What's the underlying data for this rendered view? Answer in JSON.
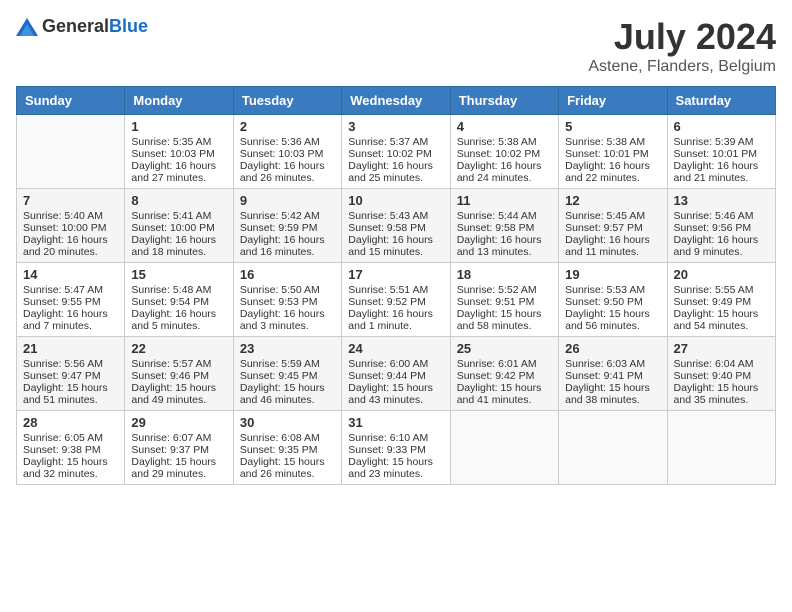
{
  "header": {
    "logo_general": "General",
    "logo_blue": "Blue",
    "month_year": "July 2024",
    "location": "Astene, Flanders, Belgium"
  },
  "days_of_week": [
    "Sunday",
    "Monday",
    "Tuesday",
    "Wednesday",
    "Thursday",
    "Friday",
    "Saturday"
  ],
  "weeks": [
    [
      {
        "day": "",
        "sunrise": "",
        "sunset": "",
        "daylight": ""
      },
      {
        "day": "1",
        "sunrise": "Sunrise: 5:35 AM",
        "sunset": "Sunset: 10:03 PM",
        "daylight": "Daylight: 16 hours and 27 minutes."
      },
      {
        "day": "2",
        "sunrise": "Sunrise: 5:36 AM",
        "sunset": "Sunset: 10:03 PM",
        "daylight": "Daylight: 16 hours and 26 minutes."
      },
      {
        "day": "3",
        "sunrise": "Sunrise: 5:37 AM",
        "sunset": "Sunset: 10:02 PM",
        "daylight": "Daylight: 16 hours and 25 minutes."
      },
      {
        "day": "4",
        "sunrise": "Sunrise: 5:38 AM",
        "sunset": "Sunset: 10:02 PM",
        "daylight": "Daylight: 16 hours and 24 minutes."
      },
      {
        "day": "5",
        "sunrise": "Sunrise: 5:38 AM",
        "sunset": "Sunset: 10:01 PM",
        "daylight": "Daylight: 16 hours and 22 minutes."
      },
      {
        "day": "6",
        "sunrise": "Sunrise: 5:39 AM",
        "sunset": "Sunset: 10:01 PM",
        "daylight": "Daylight: 16 hours and 21 minutes."
      }
    ],
    [
      {
        "day": "7",
        "sunrise": "Sunrise: 5:40 AM",
        "sunset": "Sunset: 10:00 PM",
        "daylight": "Daylight: 16 hours and 20 minutes."
      },
      {
        "day": "8",
        "sunrise": "Sunrise: 5:41 AM",
        "sunset": "Sunset: 10:00 PM",
        "daylight": "Daylight: 16 hours and 18 minutes."
      },
      {
        "day": "9",
        "sunrise": "Sunrise: 5:42 AM",
        "sunset": "Sunset: 9:59 PM",
        "daylight": "Daylight: 16 hours and 16 minutes."
      },
      {
        "day": "10",
        "sunrise": "Sunrise: 5:43 AM",
        "sunset": "Sunset: 9:58 PM",
        "daylight": "Daylight: 16 hours and 15 minutes."
      },
      {
        "day": "11",
        "sunrise": "Sunrise: 5:44 AM",
        "sunset": "Sunset: 9:58 PM",
        "daylight": "Daylight: 16 hours and 13 minutes."
      },
      {
        "day": "12",
        "sunrise": "Sunrise: 5:45 AM",
        "sunset": "Sunset: 9:57 PM",
        "daylight": "Daylight: 16 hours and 11 minutes."
      },
      {
        "day": "13",
        "sunrise": "Sunrise: 5:46 AM",
        "sunset": "Sunset: 9:56 PM",
        "daylight": "Daylight: 16 hours and 9 minutes."
      }
    ],
    [
      {
        "day": "14",
        "sunrise": "Sunrise: 5:47 AM",
        "sunset": "Sunset: 9:55 PM",
        "daylight": "Daylight: 16 hours and 7 minutes."
      },
      {
        "day": "15",
        "sunrise": "Sunrise: 5:48 AM",
        "sunset": "Sunset: 9:54 PM",
        "daylight": "Daylight: 16 hours and 5 minutes."
      },
      {
        "day": "16",
        "sunrise": "Sunrise: 5:50 AM",
        "sunset": "Sunset: 9:53 PM",
        "daylight": "Daylight: 16 hours and 3 minutes."
      },
      {
        "day": "17",
        "sunrise": "Sunrise: 5:51 AM",
        "sunset": "Sunset: 9:52 PM",
        "daylight": "Daylight: 16 hours and 1 minute."
      },
      {
        "day": "18",
        "sunrise": "Sunrise: 5:52 AM",
        "sunset": "Sunset: 9:51 PM",
        "daylight": "Daylight: 15 hours and 58 minutes."
      },
      {
        "day": "19",
        "sunrise": "Sunrise: 5:53 AM",
        "sunset": "Sunset: 9:50 PM",
        "daylight": "Daylight: 15 hours and 56 minutes."
      },
      {
        "day": "20",
        "sunrise": "Sunrise: 5:55 AM",
        "sunset": "Sunset: 9:49 PM",
        "daylight": "Daylight: 15 hours and 54 minutes."
      }
    ],
    [
      {
        "day": "21",
        "sunrise": "Sunrise: 5:56 AM",
        "sunset": "Sunset: 9:47 PM",
        "daylight": "Daylight: 15 hours and 51 minutes."
      },
      {
        "day": "22",
        "sunrise": "Sunrise: 5:57 AM",
        "sunset": "Sunset: 9:46 PM",
        "daylight": "Daylight: 15 hours and 49 minutes."
      },
      {
        "day": "23",
        "sunrise": "Sunrise: 5:59 AM",
        "sunset": "Sunset: 9:45 PM",
        "daylight": "Daylight: 15 hours and 46 minutes."
      },
      {
        "day": "24",
        "sunrise": "Sunrise: 6:00 AM",
        "sunset": "Sunset: 9:44 PM",
        "daylight": "Daylight: 15 hours and 43 minutes."
      },
      {
        "day": "25",
        "sunrise": "Sunrise: 6:01 AM",
        "sunset": "Sunset: 9:42 PM",
        "daylight": "Daylight: 15 hours and 41 minutes."
      },
      {
        "day": "26",
        "sunrise": "Sunrise: 6:03 AM",
        "sunset": "Sunset: 9:41 PM",
        "daylight": "Daylight: 15 hours and 38 minutes."
      },
      {
        "day": "27",
        "sunrise": "Sunrise: 6:04 AM",
        "sunset": "Sunset: 9:40 PM",
        "daylight": "Daylight: 15 hours and 35 minutes."
      }
    ],
    [
      {
        "day": "28",
        "sunrise": "Sunrise: 6:05 AM",
        "sunset": "Sunset: 9:38 PM",
        "daylight": "Daylight: 15 hours and 32 minutes."
      },
      {
        "day": "29",
        "sunrise": "Sunrise: 6:07 AM",
        "sunset": "Sunset: 9:37 PM",
        "daylight": "Daylight: 15 hours and 29 minutes."
      },
      {
        "day": "30",
        "sunrise": "Sunrise: 6:08 AM",
        "sunset": "Sunset: 9:35 PM",
        "daylight": "Daylight: 15 hours and 26 minutes."
      },
      {
        "day": "31",
        "sunrise": "Sunrise: 6:10 AM",
        "sunset": "Sunset: 9:33 PM",
        "daylight": "Daylight: 15 hours and 23 minutes."
      },
      {
        "day": "",
        "sunrise": "",
        "sunset": "",
        "daylight": ""
      },
      {
        "day": "",
        "sunrise": "",
        "sunset": "",
        "daylight": ""
      },
      {
        "day": "",
        "sunrise": "",
        "sunset": "",
        "daylight": ""
      }
    ]
  ]
}
